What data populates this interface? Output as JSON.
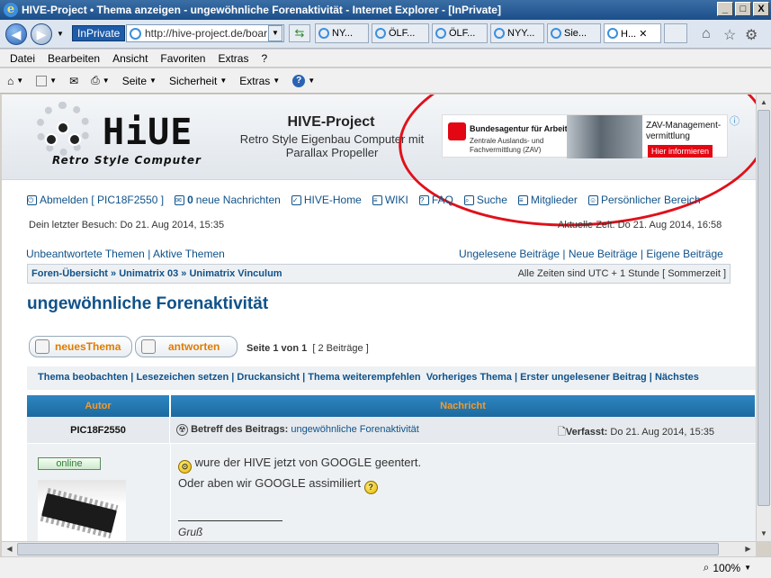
{
  "window": {
    "title": "HIVE-Project • Thema anzeigen - ungewöhnliche Forenaktivität - Internet Explorer - [InPrivate]",
    "buttons": {
      "minimize": "_",
      "maximize": "□",
      "close": "X"
    }
  },
  "addressbar": {
    "inprivate_label": "InPrivate",
    "url": "http://hive-project.de/boar"
  },
  "tabs": [
    {
      "label": "NY..."
    },
    {
      "label": "ÖLF..."
    },
    {
      "label": "ÖLF..."
    },
    {
      "label": "NYY..."
    },
    {
      "label": "Sie..."
    },
    {
      "label": "H..."
    }
  ],
  "active_tab_close": "✕",
  "menubar": [
    "Datei",
    "Bearbeiten",
    "Ansicht",
    "Favoriten",
    "Extras",
    "?"
  ],
  "commandbar": {
    "seite": "Seite",
    "sicherheit": "Sicherheit",
    "extras": "Extras"
  },
  "site": {
    "logo_text": "HiUE",
    "logo_sub": "Retro Style Computer",
    "title": "HIVE-Project",
    "description": "Retro Style Eigenbau Computer mit Parallax Propeller"
  },
  "ad": {
    "org": "Bundesagentur für Arbeit",
    "sub": "Zentrale Auslands- und Fachvermittlung (ZAV)",
    "headline": "ZAV-Management-vermittlung",
    "cta": "Hier informieren"
  },
  "nav": {
    "logout": "Abmelden [ PIC18F2550 ]",
    "messages_count": "0",
    "messages_label": "neue Nachrichten",
    "home": "HIVE-Home",
    "wiki": "WIKI",
    "faq": "FAQ",
    "search": "Suche",
    "members": "Mitglieder",
    "profile": "Persönlicher Bereich"
  },
  "last_visit": "Dein letzter Besuch: Do 21. Aug 2014, 15:35",
  "current_time": "Aktuelle Zeit: Do 21. Aug 2014, 16:58",
  "quicklinks_left": {
    "unanswered": "Unbeantwortete Themen",
    "active": "Aktive Themen"
  },
  "quicklinks_right": {
    "unread": "Ungelesene Beiträge",
    "new": "Neue Beiträge",
    "own": "Eigene Beiträge"
  },
  "breadcrumb": {
    "a": "Foren-Übersicht",
    "b": "Unimatrix 03",
    "c": "Unimatrix Vinculum"
  },
  "timezone": "Alle Zeiten sind UTC + 1 Stunde [ Sommerzeit ]",
  "topic_title": "ungewöhnliche Forenaktivität",
  "buttons": {
    "new_topic_a": "neues",
    "new_topic_b": "Thema",
    "reply": "antworten"
  },
  "pagination": {
    "page": "Seite 1 von 1",
    "posts": "[ 2 Beiträge ]"
  },
  "actions": [
    "Thema beobachten",
    "Lesezeichen setzen",
    "Druckansicht",
    "Thema weiterempfehlen",
    "Vorheriges Thema",
    "Erster ungelesener Beitrag",
    "Nächstes"
  ],
  "table": {
    "author": "Autor",
    "message": "Nachricht"
  },
  "post": {
    "author": "PIC18F2550",
    "subject_label": "Betreff des Beitrags:",
    "subject": "ungewöhnliche Forenaktivität",
    "posted_label": "Verfasst:",
    "posted": "Do 21. Aug 2014, 15:35",
    "status": "online",
    "line1": "wure der HIVE jetzt von GOOGLE geentert.",
    "line2": "Oder aben wir GOOGLE assimiliert",
    "signoff": "Gruß"
  },
  "status": {
    "zoom": "100%"
  },
  "colors": {
    "link": "#105289",
    "accent_orange": "#e07b00",
    "header_blue": "#1b6aa0",
    "annotation_red": "#e0101a"
  }
}
